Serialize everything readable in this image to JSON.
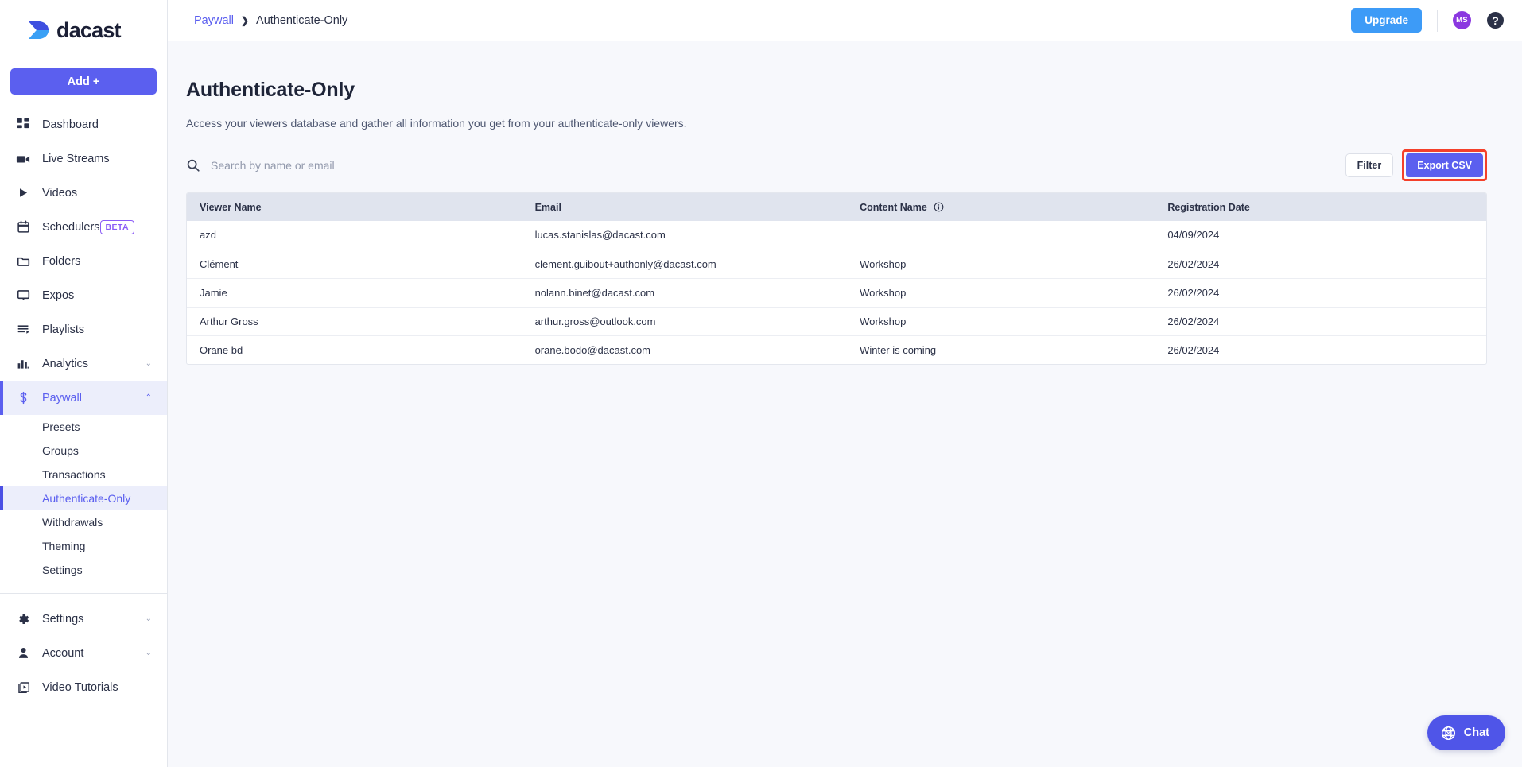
{
  "brand": {
    "name": "dacast",
    "accent": "#5b5fef",
    "logo_icon": "dacast-chevron-logo"
  },
  "sidebar": {
    "add_button": "Add +",
    "items": [
      {
        "label": "Dashboard",
        "icon": "dashboard-grid-icon",
        "has_chevron": false
      },
      {
        "label": "Live Streams",
        "icon": "video-camera-icon",
        "has_chevron": false
      },
      {
        "label": "Videos",
        "icon": "play-triangle-icon",
        "has_chevron": false
      },
      {
        "label": "Schedulers",
        "icon": "calendar-icon",
        "badge": "BETA",
        "has_chevron": false
      },
      {
        "label": "Folders",
        "icon": "folder-icon",
        "has_chevron": false
      },
      {
        "label": "Expos",
        "icon": "monitor-icon",
        "has_chevron": false
      },
      {
        "label": "Playlists",
        "icon": "playlist-icon",
        "has_chevron": false
      },
      {
        "label": "Analytics",
        "icon": "bar-chart-icon",
        "has_chevron": true,
        "chevron": "⌄"
      },
      {
        "label": "Paywall",
        "icon": "dollar-sign-icon",
        "has_chevron": true,
        "chevron": "⌃",
        "active": true
      }
    ],
    "paywall_subitems": [
      {
        "label": "Presets"
      },
      {
        "label": "Groups"
      },
      {
        "label": "Transactions"
      },
      {
        "label": "Authenticate-Only",
        "active": true
      },
      {
        "label": "Withdrawals"
      },
      {
        "label": "Theming"
      },
      {
        "label": "Settings"
      }
    ],
    "bottom_items": [
      {
        "label": "Settings",
        "icon": "gear-icon",
        "has_chevron": true,
        "chevron": "⌄"
      },
      {
        "label": "Account",
        "icon": "person-icon",
        "has_chevron": true,
        "chevron": "⌄"
      },
      {
        "label": "Video Tutorials",
        "icon": "video-tutorial-icon",
        "has_chevron": false
      }
    ]
  },
  "topbar": {
    "breadcrumb_parent": "Paywall",
    "breadcrumb_separator": "❯",
    "breadcrumb_current": "Authenticate-Only",
    "upgrade_label": "Upgrade",
    "avatar_initials": "MS",
    "help_glyph": "?"
  },
  "page": {
    "title": "Authenticate-Only",
    "description": "Access your viewers database and gather all information you get from your authenticate-only viewers."
  },
  "toolbar": {
    "search_placeholder": "Search by name or email",
    "search_value": "",
    "filter_label": "Filter",
    "export_label": "Export CSV",
    "export_highlight_color": "#f4402a"
  },
  "table": {
    "columns": [
      "Viewer Name",
      "Email",
      "Content Name",
      "Registration Date"
    ],
    "content_name_has_info_icon": true,
    "rows": [
      {
        "viewer_name": "azd",
        "email": "lucas.stanislas@dacast.com",
        "content_name": "",
        "registration_date": "04/09/2024"
      },
      {
        "viewer_name": "Clément",
        "email": "clement.guibout+authonly@dacast.com",
        "content_name": "Workshop",
        "registration_date": "26/02/2024"
      },
      {
        "viewer_name": "Jamie",
        "email": "nolann.binet@dacast.com",
        "content_name": "Workshop",
        "registration_date": "26/02/2024"
      },
      {
        "viewer_name": "Arthur Gross",
        "email": "arthur.gross@outlook.com",
        "content_name": "Workshop",
        "registration_date": "26/02/2024"
      },
      {
        "viewer_name": "Orane bd",
        "email": "orane.bodo@dacast.com",
        "content_name": "Winter is coming",
        "registration_date": "26/02/2024"
      }
    ]
  },
  "chat": {
    "label": "Chat",
    "icon": "globe-compass-icon"
  }
}
